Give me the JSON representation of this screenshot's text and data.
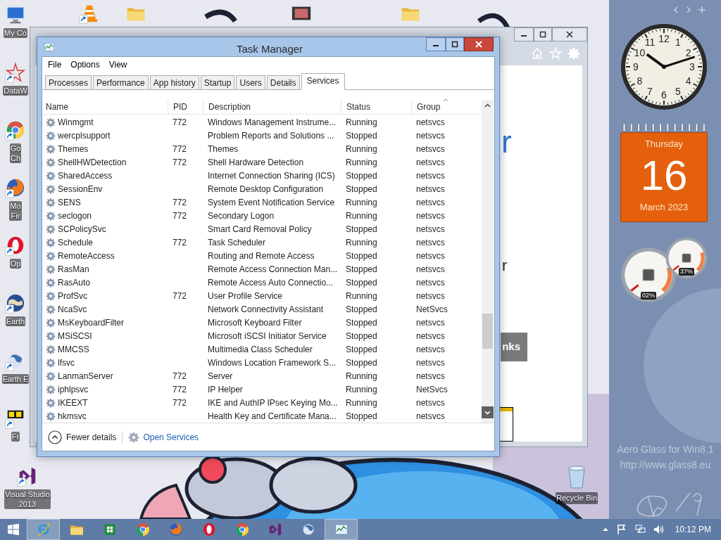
{
  "desktop": {
    "icons": [
      {
        "kind": "computer",
        "shortcut": false,
        "label": [
          "My Co"
        ]
      },
      {
        "kind": "dataw",
        "shortcut": true,
        "label": [
          "DataW"
        ]
      },
      {
        "kind": "chrome",
        "shortcut": true,
        "label": [
          "Go",
          "Ch"
        ]
      },
      {
        "kind": "firefox",
        "shortcut": true,
        "label": [
          "Mo",
          "Fir"
        ]
      },
      {
        "kind": "opera",
        "shortcut": true,
        "label": [
          "Op"
        ]
      },
      {
        "kind": "earth",
        "shortcut": true,
        "label": [
          "Earth"
        ]
      },
      {
        "kind": "globe",
        "shortcut": true,
        "label": [
          "Earth E"
        ]
      },
      {
        "kind": "fr",
        "shortcut": true,
        "label": [
          "Fr"
        ]
      },
      {
        "kind": "vs",
        "shortcut": true,
        "label": [
          "Visual Studio",
          "2013"
        ]
      }
    ],
    "top_icons": [
      {
        "kind": "vlc",
        "shortcut": true
      },
      {
        "kind": "folder",
        "shortcut": false
      },
      {
        "kind": "film",
        "shortcut": false
      },
      {
        "kind": "folder",
        "shortcut": false
      }
    ],
    "recycle_bin": {
      "label": "Recycle Bin"
    },
    "aero_notice": [
      "Aero Glass for Win8.1",
      "http://www.glass8.eu"
    ]
  },
  "background_window": {
    "heading_fragment": "r",
    "line_fragment": "r",
    "button_fragment": "nks"
  },
  "task_manager": {
    "title": "Task Manager",
    "menu": [
      "File",
      "Options",
      "View"
    ],
    "tabs": [
      {
        "label": "Processes",
        "selected": false
      },
      {
        "label": "Performance",
        "selected": false
      },
      {
        "label": "App history",
        "selected": false
      },
      {
        "label": "Startup",
        "selected": false
      },
      {
        "label": "Users",
        "selected": false
      },
      {
        "label": "Details",
        "selected": false
      },
      {
        "label": "Services",
        "selected": true
      }
    ],
    "columns": [
      {
        "label": "Name",
        "sorted": false
      },
      {
        "label": "PID",
        "sorted": false
      },
      {
        "label": "Description",
        "sorted": false
      },
      {
        "label": "Status",
        "sorted": false
      },
      {
        "label": "Group",
        "sorted": true
      }
    ],
    "rows": [
      {
        "name": "Winmgmt",
        "pid": "772",
        "description": "Windows Management Instrume...",
        "status": "Running",
        "group": "netsvcs"
      },
      {
        "name": "wercplsupport",
        "pid": "",
        "description": "Problem Reports and Solutions ...",
        "status": "Stopped",
        "group": "netsvcs"
      },
      {
        "name": "Themes",
        "pid": "772",
        "description": "Themes",
        "status": "Running",
        "group": "netsvcs"
      },
      {
        "name": "ShellHWDetection",
        "pid": "772",
        "description": "Shell Hardware Detection",
        "status": "Running",
        "group": "netsvcs"
      },
      {
        "name": "SharedAccess",
        "pid": "",
        "description": "Internet Connection Sharing (ICS)",
        "status": "Stopped",
        "group": "netsvcs"
      },
      {
        "name": "SessionEnv",
        "pid": "",
        "description": "Remote Desktop Configuration",
        "status": "Stopped",
        "group": "netsvcs"
      },
      {
        "name": "SENS",
        "pid": "772",
        "description": "System Event Notification Service",
        "status": "Running",
        "group": "netsvcs"
      },
      {
        "name": "seclogon",
        "pid": "772",
        "description": "Secondary Logon",
        "status": "Running",
        "group": "netsvcs"
      },
      {
        "name": "SCPolicySvc",
        "pid": "",
        "description": "Smart Card Removal Policy",
        "status": "Stopped",
        "group": "netsvcs"
      },
      {
        "name": "Schedule",
        "pid": "772",
        "description": "Task Scheduler",
        "status": "Running",
        "group": "netsvcs"
      },
      {
        "name": "RemoteAccess",
        "pid": "",
        "description": "Routing and Remote Access",
        "status": "Stopped",
        "group": "netsvcs"
      },
      {
        "name": "RasMan",
        "pid": "",
        "description": "Remote Access Connection Man...",
        "status": "Stopped",
        "group": "netsvcs"
      },
      {
        "name": "RasAuto",
        "pid": "",
        "description": "Remote Access Auto Connectio...",
        "status": "Stopped",
        "group": "netsvcs"
      },
      {
        "name": "ProfSvc",
        "pid": "772",
        "description": "User Profile Service",
        "status": "Running",
        "group": "netsvcs"
      },
      {
        "name": "NcaSvc",
        "pid": "",
        "description": "Network Connectivity Assistant",
        "status": "Stopped",
        "group": "NetSvcs"
      },
      {
        "name": "MsKeyboardFilter",
        "pid": "",
        "description": "Microsoft Keyboard Filter",
        "status": "Stopped",
        "group": "netsvcs"
      },
      {
        "name": "MSiSCSI",
        "pid": "",
        "description": "Microsoft iSCSI Initiator Service",
        "status": "Stopped",
        "group": "netsvcs"
      },
      {
        "name": "MMCSS",
        "pid": "",
        "description": "Multimedia Class Scheduler",
        "status": "Stopped",
        "group": "netsvcs"
      },
      {
        "name": "lfsvc",
        "pid": "",
        "description": "Windows Location Framework S...",
        "status": "Stopped",
        "group": "netsvcs"
      },
      {
        "name": "LanmanServer",
        "pid": "772",
        "description": "Server",
        "status": "Running",
        "group": "netsvcs"
      },
      {
        "name": "iphlpsvc",
        "pid": "772",
        "description": "IP Helper",
        "status": "Running",
        "group": "NetSvcs"
      },
      {
        "name": "IKEEXT",
        "pid": "772",
        "description": "IKE and AuthIP IPsec Keying Mo...",
        "status": "Running",
        "group": "netsvcs"
      },
      {
        "name": "hkmsvc",
        "pid": "",
        "description": "Health Key and Certificate Mana...",
        "status": "Stopped",
        "group": "netsvcs"
      }
    ],
    "footer": {
      "fewer_details": "Fewer details",
      "open_services": "Open Services"
    }
  },
  "gadgets": {
    "clock": {
      "numerals": [
        "12",
        "11",
        "1",
        "10",
        "2",
        "9",
        "3",
        "8",
        "4",
        "7",
        "5",
        "6"
      ]
    },
    "calendar": {
      "weekday": "Thursday",
      "day": "16",
      "month_year": "March 2023"
    },
    "meters": [
      {
        "reading": "02%"
      },
      {
        "reading": "37%"
      }
    ]
  },
  "taskbar": {
    "apps": [
      {
        "kind": "ie",
        "highlighted": true
      },
      {
        "kind": "folder",
        "highlighted": false
      },
      {
        "kind": "sheet",
        "highlighted": false
      },
      {
        "kind": "chrome",
        "highlighted": false
      },
      {
        "kind": "firefox",
        "highlighted": false
      },
      {
        "kind": "opera",
        "highlighted": false
      },
      {
        "kind": "chrome",
        "highlighted": false
      },
      {
        "kind": "vs",
        "highlighted": false
      },
      {
        "kind": "globe",
        "highlighted": false
      },
      {
        "kind": "taskmgr",
        "highlighted": true
      }
    ],
    "time": "10:12 PM"
  }
}
